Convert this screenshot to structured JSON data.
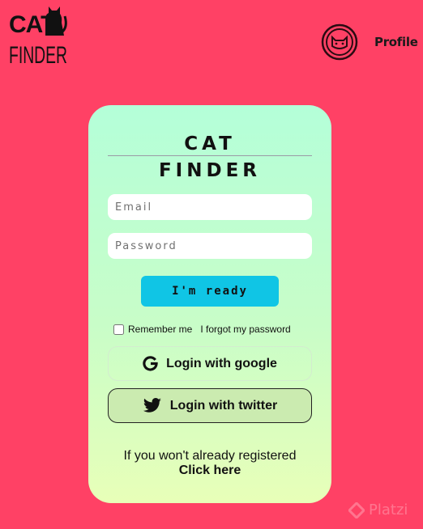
{
  "header": {
    "logo": {
      "line1": "CAT",
      "line2": "FINDER",
      "icon": "cat-silhouette-icon"
    },
    "profile": {
      "icon": "cat-face-icon",
      "label": "Profile"
    }
  },
  "card": {
    "title_line1": "CAT",
    "title_line2": "FINDER",
    "email_placeholder": "Email",
    "password_placeholder": "Password",
    "ready_label": "I'm ready",
    "remember_label": "Remember me",
    "forgot_label": "I forgot my password",
    "google_label": "Login with google",
    "twitter_label": "Login with twitter",
    "register_text": "If you won't already registered",
    "register_link": "Click here"
  },
  "watermark": "Platzi",
  "colors": {
    "background": "#ff4165",
    "card_top": "#b4ffd9",
    "card_bottom": "#e8ffb8",
    "ready_button": "#10c5e5",
    "twitter_button": "#cbebb0"
  }
}
